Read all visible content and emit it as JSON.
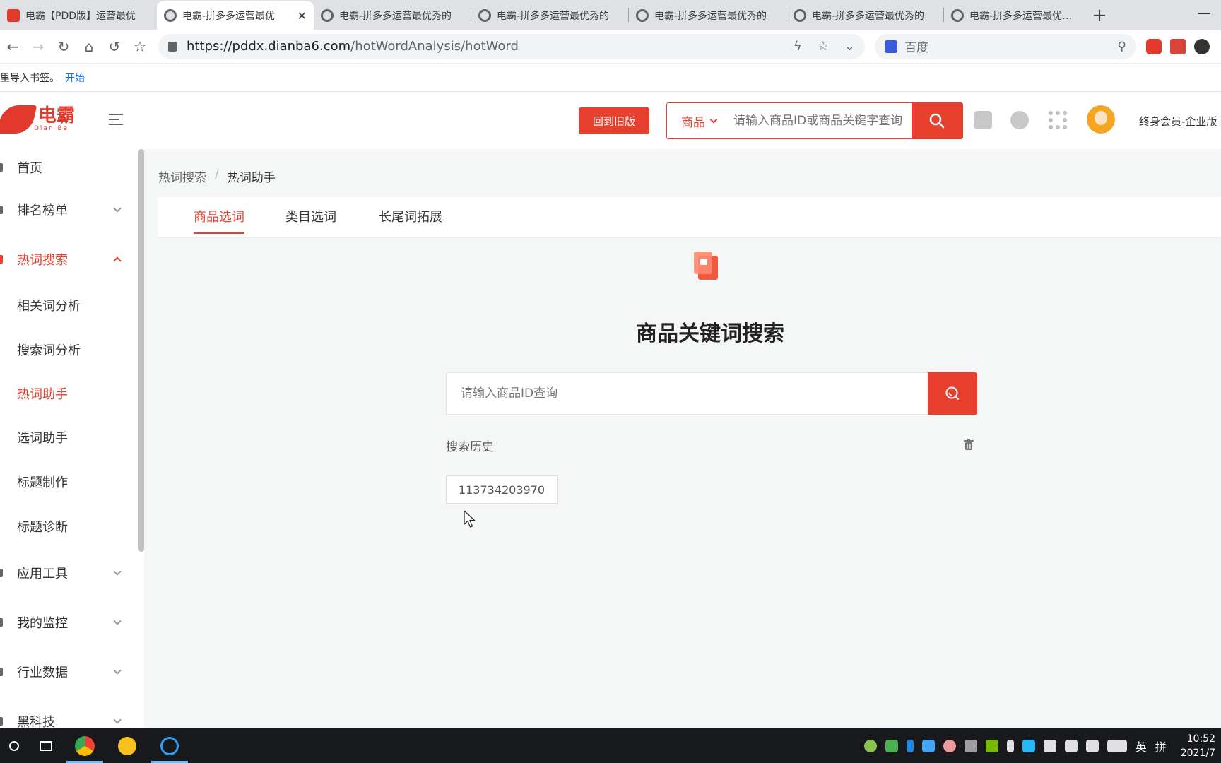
{
  "browser": {
    "tabs": [
      {
        "title": "电霸【PDD版】运营最优",
        "active": false
      },
      {
        "title": "电霸-拼多多运营最优",
        "active": true
      },
      {
        "title": "电霸-拼多多运营最优秀的",
        "active": false
      },
      {
        "title": "电霸-拼多多运营最优秀的",
        "active": false
      },
      {
        "title": "电霸-拼多多运营最优秀的",
        "active": false
      },
      {
        "title": "电霸-拼多多运营最优秀的",
        "active": false
      },
      {
        "title": "电霸-拼多多运营最优秀的",
        "active": false
      }
    ],
    "url_host": "https://pddx.dianba6.com",
    "url_path": "/hotWordAnalysis/hotWord",
    "search_engine": "百度",
    "bookmark_hint": "里导入书签。",
    "bookmark_start": "开始"
  },
  "header": {
    "logo_text": "电霸",
    "logo_sub": "Dian Ba",
    "old_version_button": "回到旧版",
    "search_category": "商品",
    "search_placeholder": "请输入商品ID或商品关键字查询",
    "member_label": "终身会员-企业版"
  },
  "sidebar": {
    "items": [
      {
        "label": "首页",
        "active": false,
        "chevron": "none"
      },
      {
        "label": "排名榜单",
        "active": false,
        "chevron": "down"
      },
      {
        "label": "热词搜索",
        "active": true,
        "chevron": "up"
      },
      {
        "label": "相关词分析",
        "active": false,
        "chevron": "none",
        "sub": true
      },
      {
        "label": "搜索词分析",
        "active": false,
        "chevron": "none",
        "sub": true
      },
      {
        "label": "热词助手",
        "active": true,
        "chevron": "none",
        "sub": true
      },
      {
        "label": "选词助手",
        "active": false,
        "chevron": "none",
        "sub": true
      },
      {
        "label": "标题制作",
        "active": false,
        "chevron": "none",
        "sub": true
      },
      {
        "label": "标题诊断",
        "active": false,
        "chevron": "none",
        "sub": true
      },
      {
        "label": "应用工具",
        "active": false,
        "chevron": "down"
      },
      {
        "label": "我的监控",
        "active": false,
        "chevron": "down"
      },
      {
        "label": "行业数据",
        "active": false,
        "chevron": "down"
      },
      {
        "label": "黑科技",
        "active": false,
        "chevron": "down"
      }
    ]
  },
  "main": {
    "breadcrumb": [
      "热词搜索",
      "热词助手"
    ],
    "breadcrumb_sep": "/",
    "tabs": [
      {
        "label": "商品选词",
        "active": true
      },
      {
        "label": "类目选词",
        "active": false
      },
      {
        "label": "长尾词拓展",
        "active": false
      }
    ],
    "title": "商品关键词搜索",
    "search_placeholder": "请输入商品ID查询",
    "history_label": "搜索历史",
    "history_items": [
      "113734203970"
    ]
  },
  "taskbar": {
    "ime_lang": "英",
    "ime_mode": "拼",
    "time": "10:52",
    "date": "2021/7"
  },
  "colors": {
    "accent": "#e8402e",
    "sidebar_active": "#e8402e",
    "taskbar": "#17191d"
  }
}
